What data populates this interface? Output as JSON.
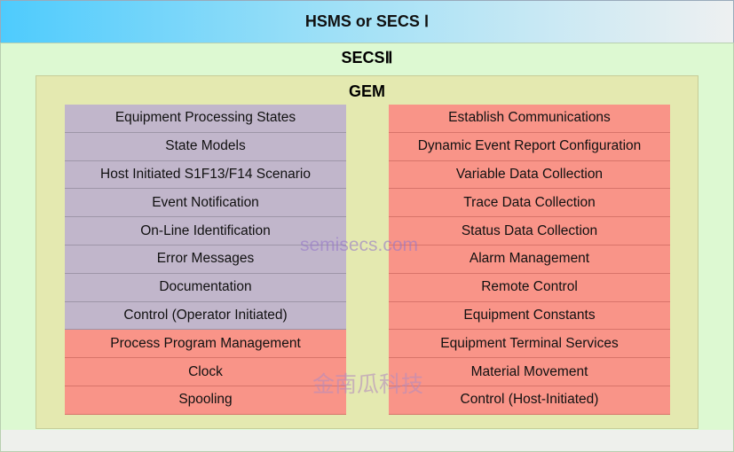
{
  "layers": {
    "hsms": "HSMS or SECS Ⅰ",
    "secs2": "SECSⅡ",
    "gem": "GEM"
  },
  "left": [
    {
      "label": "Equipment Processing States",
      "color": "purple"
    },
    {
      "label": "State Models",
      "color": "purple"
    },
    {
      "label": "Host Initiated S1F13/F14 Scenario",
      "color": "purple"
    },
    {
      "label": "Event Notification",
      "color": "purple"
    },
    {
      "label": "On-Line Identification",
      "color": "purple"
    },
    {
      "label": "Error Messages",
      "color": "purple"
    },
    {
      "label": "Documentation",
      "color": "purple"
    },
    {
      "label": "Control (Operator Initiated)",
      "color": "purple"
    },
    {
      "label": "Process Program Management",
      "color": "red"
    },
    {
      "label": "Clock",
      "color": "red"
    },
    {
      "label": "Spooling",
      "color": "red"
    }
  ],
  "right": [
    {
      "label": "Establish Communications"
    },
    {
      "label": "Dynamic Event Report Configuration"
    },
    {
      "label": "Variable Data Collection"
    },
    {
      "label": "Trace Data Collection"
    },
    {
      "label": "Status Data Collection"
    },
    {
      "label": "Alarm Management"
    },
    {
      "label": "Remote Control"
    },
    {
      "label": "Equipment Constants"
    },
    {
      "label": "Equipment Terminal Services"
    },
    {
      "label": "Material Movement"
    },
    {
      "label": "Control (Host-Initiated)"
    }
  ],
  "watermarks": {
    "site": "semisecs.com",
    "company": "金南瓜科技"
  }
}
